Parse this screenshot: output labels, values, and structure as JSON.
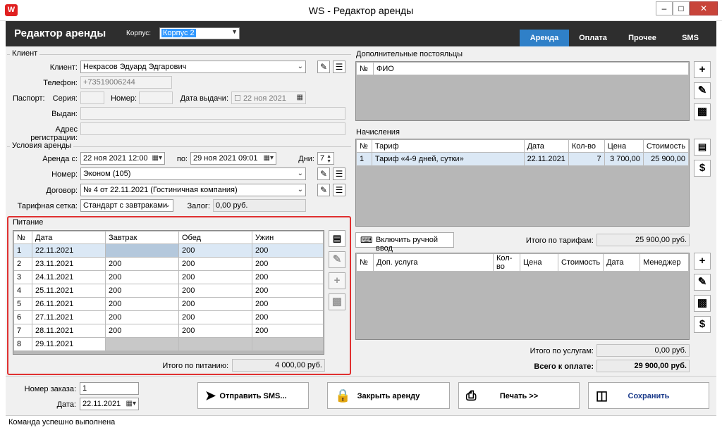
{
  "window": {
    "title": "WS - Редактор аренды",
    "icon_letter": "W"
  },
  "header": {
    "title": "Редактор аренды",
    "korpus_label": "Корпус:",
    "korpus_value": "Корпус 2",
    "tabs": [
      "Аренда",
      "Оплата",
      "Прочее",
      "SMS"
    ]
  },
  "client": {
    "section": "Клиент",
    "client_label": "Клиент:",
    "client_value": "Некрасов Эдуард Эдгарович",
    "phone_label": "Телефон:",
    "phone_value": "+73519006244",
    "passport_label": "Паспорт:",
    "series_label": "Серия:",
    "number_label": "Номер:",
    "issue_date_label": "Дата выдачи:",
    "issue_date_value": "22 ноя 2021",
    "issued_label": "Выдан:",
    "address_label": "Адрес регистрации:"
  },
  "conditions": {
    "section": "Условия аренды",
    "from_label": "Аренда с:",
    "from_value": "22 ноя 2021 12:00",
    "to_label": "по:",
    "to_value": "29 ноя 2021 09:01",
    "days_label": "Дни:",
    "days_value": "7",
    "room_label": "Номер:",
    "room_value": "Эконом (105)",
    "contract_label": "Договор:",
    "contract_value": "№ 4 от 22.11.2021 (Гостиничная компания)",
    "grid_label": "Тарифная сетка:",
    "grid_value": "Стандарт с завтраками",
    "deposit_label": "Залог:",
    "deposit_value": "0,00 руб."
  },
  "meals": {
    "section": "Питание",
    "columns": [
      "№",
      "Дата",
      "Завтрак",
      "Обед",
      "Ужин"
    ],
    "rows": [
      [
        "1",
        "22.11.2021",
        "",
        "200",
        "200"
      ],
      [
        "2",
        "23.11.2021",
        "200",
        "200",
        "200"
      ],
      [
        "3",
        "24.11.2021",
        "200",
        "200",
        "200"
      ],
      [
        "4",
        "25.11.2021",
        "200",
        "200",
        "200"
      ],
      [
        "5",
        "26.11.2021",
        "200",
        "200",
        "200"
      ],
      [
        "6",
        "27.11.2021",
        "200",
        "200",
        "200"
      ],
      [
        "7",
        "28.11.2021",
        "200",
        "200",
        "200"
      ],
      [
        "8",
        "29.11.2021",
        "",
        "",
        ""
      ]
    ],
    "total_label": "Итого по питанию:",
    "total_value": "4 000,00 руб."
  },
  "guests": {
    "section": "Дополнительные постояльцы",
    "columns": [
      "№",
      "ФИО"
    ]
  },
  "charges": {
    "section": "Начисления",
    "columns": [
      "№",
      "Тариф",
      "Дата",
      "Кол-во",
      "Цена",
      "Стоимость"
    ],
    "rows": [
      [
        "1",
        "Тариф «4-9 дней, сутки»",
        "22.11.2021",
        "7",
        "3 700,00",
        "25 900,00"
      ]
    ],
    "manual_button": "Включить ручной ввод",
    "tariff_total_label": "Итого по тарифам:",
    "tariff_total_value": "25 900,00 руб."
  },
  "services": {
    "columns": [
      "№",
      "Доп. услуга",
      "Кол-во",
      "Цена",
      "Стоимость",
      "Дата",
      "Менеджер"
    ],
    "total_label": "Итого по услугам:",
    "total_value": "0,00 руб.",
    "grand_label": "Всего к оплате:",
    "grand_value": "29 900,00 руб."
  },
  "bottom": {
    "order_label": "Номер заказа:",
    "order_value": "1",
    "date_label": "Дата:",
    "date_value": "22.11.2021",
    "sms_button": "Отправить SMS...",
    "close_button": "Закрыть аренду",
    "print_button": "Печать  >>",
    "save_button": "Сохранить"
  },
  "status": "Команда успешно выполнена",
  "colors": {
    "accent": "#2f80c8",
    "header": "#2e2e2e",
    "highlight_border": "#e03030",
    "save_text": "#1a3a8a"
  }
}
